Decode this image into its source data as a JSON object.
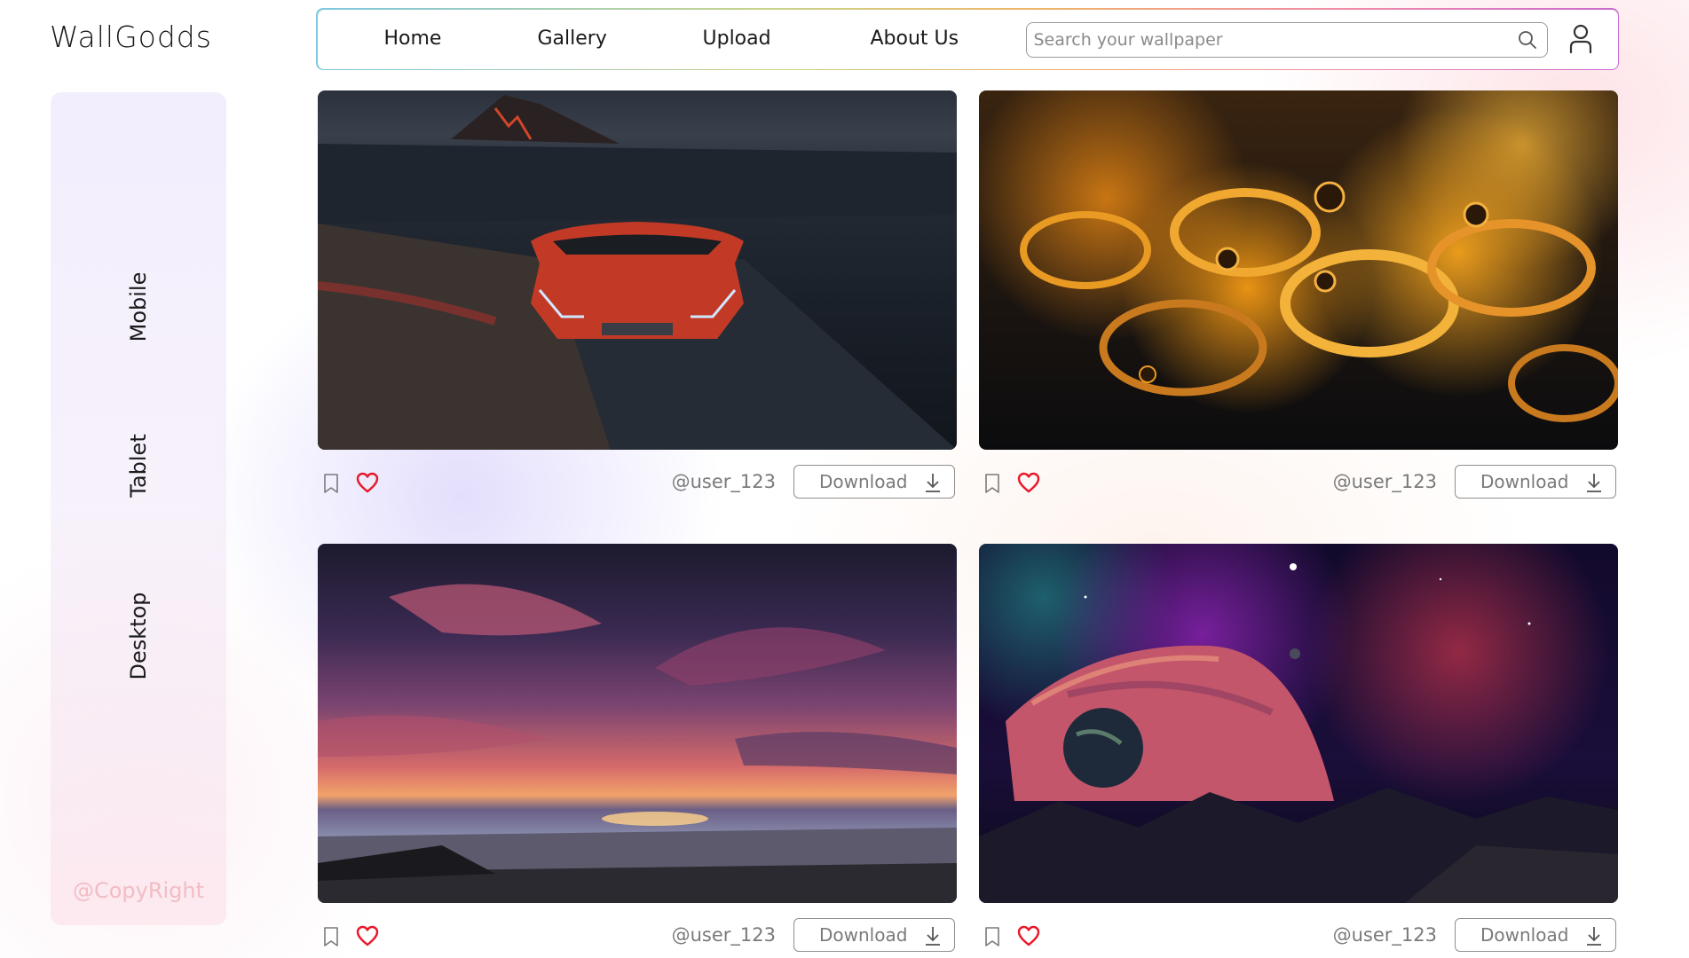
{
  "brand": {
    "name": "WallGodds"
  },
  "nav": {
    "links": [
      "Home",
      "Gallery",
      "Upload",
      "About Us"
    ],
    "search_placeholder": "Search your wallpaper",
    "search_value": ""
  },
  "sidebar": {
    "items": [
      "Mobile",
      "Tablet",
      "Desktop"
    ],
    "copyright": "@CopyRight"
  },
  "wallpapers": [
    {
      "subject": "red sports car on dark road",
      "username": "@user_123",
      "download_label": "Download",
      "liked": true,
      "bookmarked": false
    },
    {
      "subject": "amber oil droplets macro",
      "username": "@user_123",
      "download_label": "Download",
      "liked": true,
      "bookmarked": false
    },
    {
      "subject": "purple sunset over ocean",
      "username": "@user_123",
      "download_label": "Download",
      "liked": true,
      "bookmarked": false
    },
    {
      "subject": "planets in nebula over mountains",
      "username": "@user_123",
      "download_label": "Download",
      "liked": true,
      "bookmarked": false
    }
  ],
  "colors": {
    "heart": "#e8182a",
    "copyright": "#f2bcc4",
    "muted_text": "#7a7a7a"
  },
  "icons": {
    "search": "search-icon",
    "user": "user-icon",
    "bookmark": "bookmark-icon",
    "heart": "heart-icon",
    "download": "download-icon"
  }
}
